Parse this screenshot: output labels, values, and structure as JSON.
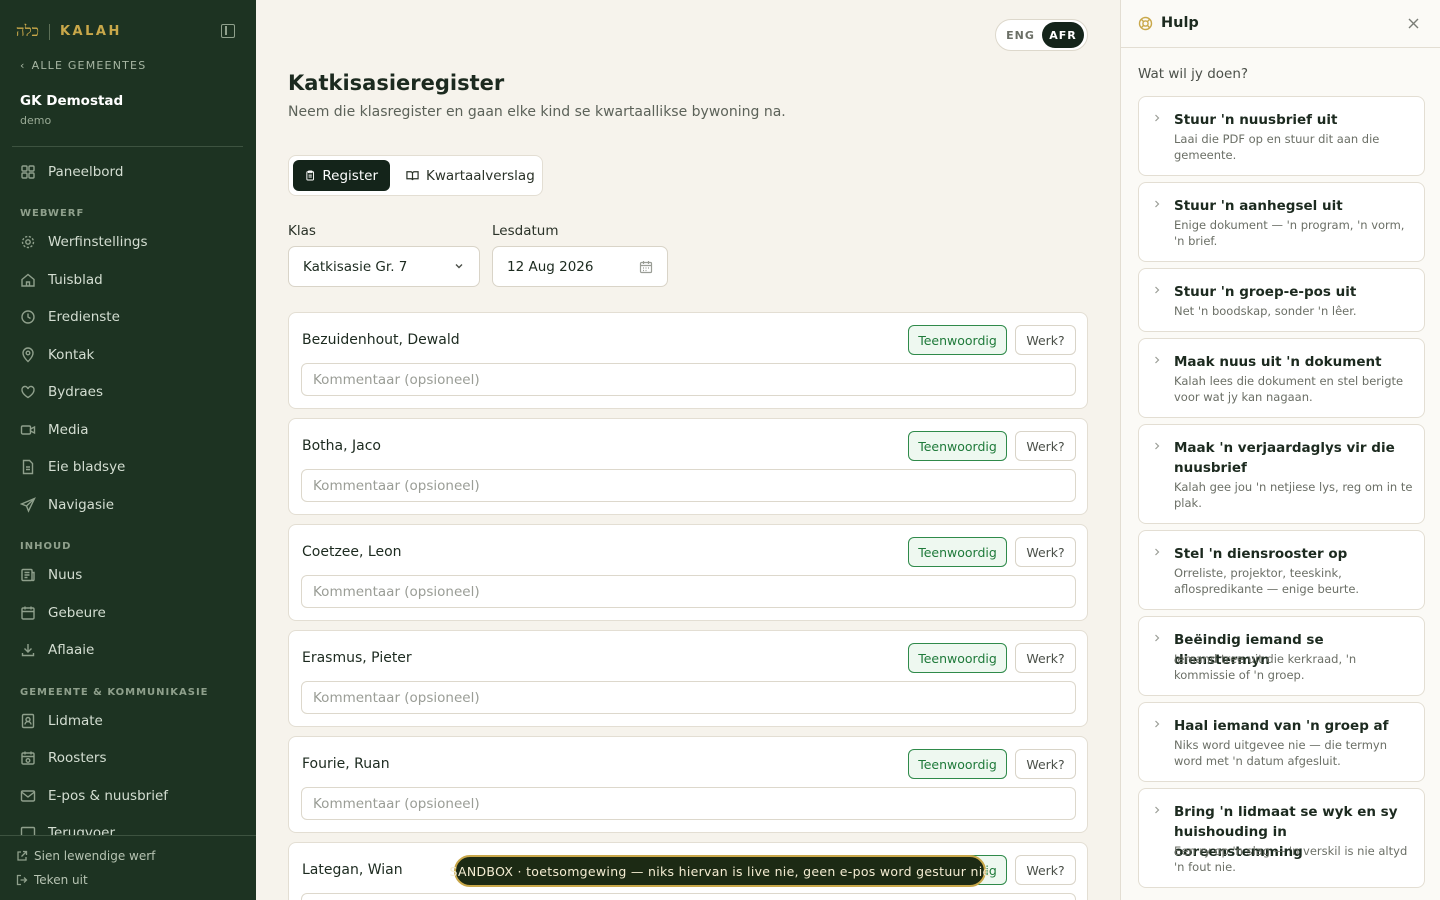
{
  "sidebar": {
    "brand_hebrew": "כלה",
    "brand_name": "KALAH",
    "back_link": "ALLE GEMEENTES",
    "church_name": "GK Demostad",
    "church_slug": "demo",
    "dashboard": "Paneelbord",
    "sections": {
      "webwerf": "WEBWERF",
      "inhoud": "INHOUD",
      "gemeente": "GEMEENTE & KOMMUNIKASIE"
    },
    "items": {
      "werfinstellings": "Werfinstellings",
      "tuisblad": "Tuisblad",
      "eredienste": "Eredienste",
      "kontak": "Kontak",
      "bydraes": "Bydraes",
      "media": "Media",
      "eie_bladsye": "Eie bladsye",
      "navigasie": "Navigasie",
      "nuus": "Nuus",
      "gebeure": "Gebeure",
      "aflaaie": "Aflaaie",
      "lidmate": "Lidmate",
      "roosters": "Roosters",
      "epos": "E-pos & nuusbrief",
      "terugvoer": "Terugvoer"
    },
    "view_live": "Sien lewendige werf",
    "sign_out": "Teken uit"
  },
  "lang": {
    "eng": "ENG",
    "afr": "AFR"
  },
  "main": {
    "title": "Katkisasieregister",
    "subtitle": "Neem die klasregister en gaan elke kind se kwartaallikse bywoning na.",
    "tabs": {
      "register": "Register",
      "report": "Kwartaalverslag"
    },
    "class_label": "Klas",
    "class_value": "Katkisasie Gr. 7",
    "date_label": "Lesdatum",
    "date_value": "12 Aug 2026",
    "present_label": "Teenwoordig",
    "work_label": "Werk?",
    "comment_placeholder": "Kommentaar (opsioneel)",
    "students": [
      "Bezuidenhout, Dewald",
      "Botha, Jaco",
      "Coetzee, Leon",
      "Erasmus, Pieter",
      "Fourie, Ruan",
      "Lategan, Wian"
    ],
    "sandbox": "SANDBOX · toetsomgewing — niks hiervan is live nie, geen e-pos word gestuur nie"
  },
  "help": {
    "title": "Hulp",
    "question": "Wat wil jy doen?",
    "cards": [
      {
        "title": "Stuur 'n nuusbrief uit",
        "desc": "Laai die PDF op en stuur dit aan die gemeente."
      },
      {
        "title": "Stuur 'n aanhegsel uit",
        "desc": "Enige dokument — 'n program, 'n vorm, 'n brief."
      },
      {
        "title": "Stuur 'n groep-e-pos uit",
        "desc": "Net 'n boodskap, sonder 'n lêer."
      },
      {
        "title": "Maak nuus uit 'n dokument",
        "desc": "Kalah lees die dokument en stel berigte voor wat jy kan nagaan."
      },
      {
        "title": "Maak 'n verjaardaglys vir die nuusbrief",
        "desc": "Kalah gee jou 'n netjiese lys, reg om in te plak."
      },
      {
        "title": "Stel 'n diensrooster op",
        "desc": "Orreliste, projektor, teeskink, aflospredikante — enige beurte."
      },
      {
        "title": "Beëindig iemand se dienstermyn",
        "desc": "Iemand tree uit die kerkraad, 'n kommissie of 'n groep."
      },
      {
        "title": "Haal iemand van 'n groep af",
        "desc": "Niks word uitgevee nie — die termyn word met 'n datum afgesluit."
      },
      {
        "title": "Bring 'n lidmaat se wyk en sy huishouding in ooreenstemming",
        "desc": "Een ry op 'n slag — 'n verskil is nie altyd 'n fout nie."
      }
    ]
  }
}
